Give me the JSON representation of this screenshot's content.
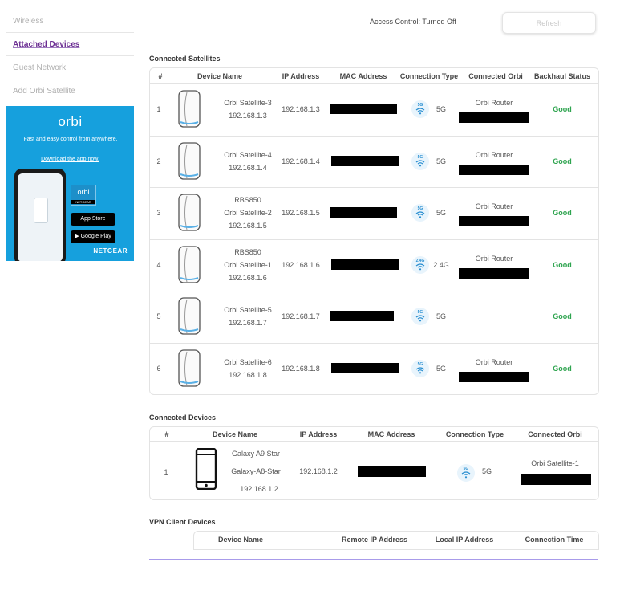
{
  "sidebar": {
    "items": [
      {
        "label": "Wireless"
      },
      {
        "label": "Attached Devices"
      },
      {
        "label": "Guest Network"
      },
      {
        "label": "Add Orbi Satellite"
      }
    ]
  },
  "promo": {
    "brand": "orbi",
    "tagline": "Fast and easy control from anywhere.",
    "download": "Download the app now.",
    "badge": "orbi",
    "badge_sub": "NETGEAR",
    "app_store": "App Store",
    "google_play": "Google Play",
    "company": "NETGEAR"
  },
  "header": {
    "access_control": "Access Control: Turned Off",
    "refresh_label": "Refresh"
  },
  "satellites": {
    "title": "Connected Satellites",
    "columns": [
      "#",
      "Device Name",
      "IP Address",
      "MAC Address",
      "Connection Type",
      "Connected Orbi",
      "Backhaul Status"
    ],
    "rows": [
      {
        "num": "1",
        "line1": "",
        "line2": "Orbi Satellite-3",
        "ip_below": "192.168.1.3",
        "ip": "192.168.1.3",
        "band_badge": "5G",
        "band": "5G",
        "orbi": "Orbi Router",
        "status": "Good"
      },
      {
        "num": "2",
        "line1": "",
        "line2": "Orbi Satellite-4",
        "ip_below": "192.168.1.4",
        "ip": "192.168.1.4",
        "band_badge": "5G",
        "band": "5G",
        "orbi": "Orbi Router",
        "status": "Good"
      },
      {
        "num": "3",
        "line1": "RBS850",
        "line2": "Orbi Satellite-2",
        "ip_below": "192.168.1.5",
        "ip": "192.168.1.5",
        "band_badge": "5G",
        "band": "5G",
        "orbi": "Orbi Router",
        "status": "Good"
      },
      {
        "num": "4",
        "line1": "RBS850",
        "line2": "Orbi Satellite-1",
        "ip_below": "192.168.1.6",
        "ip": "192.168.1.6",
        "band_badge": "2.4G",
        "band": "2.4G",
        "orbi": "Orbi Router",
        "status": "Good"
      },
      {
        "num": "5",
        "line1": "",
        "line2": "Orbi Satellite-5",
        "ip_below": "192.168.1.7",
        "ip": "192.168.1.7",
        "band_badge": "5G",
        "band": "5G",
        "orbi": "",
        "status": "Good"
      },
      {
        "num": "6",
        "line1": "",
        "line2": "Orbi Satellite-6",
        "ip_below": "192.168.1.8",
        "ip": "192.168.1.8",
        "band_badge": "5G",
        "band": "5G",
        "orbi": "Orbi Router",
        "status": "Good"
      }
    ]
  },
  "devices": {
    "title": "Connected Devices",
    "columns": [
      "#",
      "Device Name",
      "IP Address",
      "MAC Address",
      "Connection Type",
      "Connected Orbi"
    ],
    "rows": [
      {
        "num": "1",
        "name1": "Galaxy A9 Star",
        "name2": "Galaxy-A8-Star",
        "ip_below": "192.168.1.2",
        "ip": "192.168.1.2",
        "band_badge": "5G",
        "band": "5G",
        "orbi": "Orbi Satellite-1"
      }
    ]
  },
  "vpn": {
    "title": "VPN Client Devices",
    "columns": [
      "Device Name",
      "Remote IP Address",
      "Local IP Address",
      "Connection Time"
    ]
  },
  "colors": {
    "accent": "#6a2c91",
    "good": "#2ea44f",
    "promo": "#16a0dd",
    "vpn_line": "#a89bea"
  }
}
